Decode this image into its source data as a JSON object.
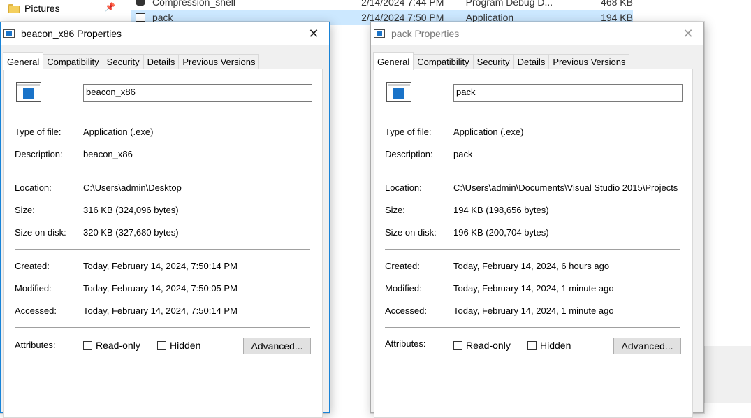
{
  "explorer": {
    "nav_item": "Pictures",
    "rows": [
      {
        "name": "Compression_shell",
        "date": "2/14/2024 7:44 PM",
        "type": "Program Debug D...",
        "size": "468 KB"
      },
      {
        "name": "pack",
        "date": "2/14/2024 7:50 PM",
        "type": "Application",
        "size": "194 KB"
      }
    ]
  },
  "dialogs": {
    "left": {
      "title": "beacon_x86 Properties",
      "tabs": [
        "General",
        "Compatibility",
        "Security",
        "Details",
        "Previous Versions"
      ],
      "name": "beacon_x86",
      "labels": {
        "type": "Type of file:",
        "description": "Description:",
        "location": "Location:",
        "size": "Size:",
        "size_on_disk": "Size on disk:",
        "created": "Created:",
        "modified": "Modified:",
        "accessed": "Accessed:",
        "attributes": "Attributes:"
      },
      "type": "Application (.exe)",
      "description": "beacon_x86",
      "location": "C:\\Users\\admin\\Desktop",
      "size": "316 KB (324,096 bytes)",
      "size_on_disk": "320 KB (327,680 bytes)",
      "created": "Today, February 14, 2024, 7:50:14 PM",
      "modified": "Today, February 14, 2024, 7:50:05 PM",
      "accessed": "Today, February 14, 2024, 7:50:14 PM",
      "readonly_label": "Read-only",
      "hidden_label": "Hidden",
      "advanced_label": "Advanced..."
    },
    "right": {
      "title": "pack Properties",
      "tabs": [
        "General",
        "Compatibility",
        "Security",
        "Details",
        "Previous Versions"
      ],
      "name": "pack",
      "labels": {
        "type": "Type of file:",
        "description": "Description:",
        "location": "Location:",
        "size": "Size:",
        "size_on_disk": "Size on disk:",
        "created": "Created:",
        "modified": "Modified:",
        "accessed": "Accessed:",
        "attributes": "Attributes:"
      },
      "type": "Application (.exe)",
      "description": "pack",
      "location": "C:\\Users\\admin\\Documents\\Visual Studio 2015\\Projects",
      "size": "194 KB (198,656 bytes)",
      "size_on_disk": "196 KB (200,704 bytes)",
      "created": "Today, February 14, 2024, 6 hours ago",
      "modified": "Today, February 14, 2024, 1 minute ago",
      "accessed": "Today, February 14, 2024, 1 minute ago",
      "readonly_label": "Read-only",
      "hidden_label": "Hidden",
      "advanced_label": "Advanced..."
    }
  },
  "colors": {
    "selection": "#cce8ff",
    "active_border": "#1883d7",
    "dialog_bg": "#f0f0f0"
  }
}
